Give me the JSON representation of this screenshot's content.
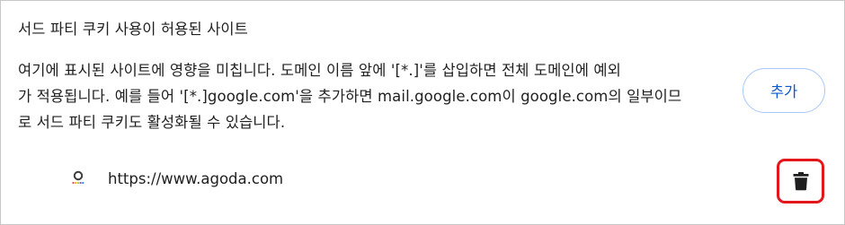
{
  "section": {
    "title": "서드 파티 쿠키 사용이 허용된 사이트",
    "description_lines": [
      "여기에 표시된 사이트에 영향을 미칩니다. 도메인 이름 앞에 '[*.]'를 삽입하면 전체 도메인에 예외",
      "가 적용됩니다. 예를 들어 '[*.]google.com'을 추가하면 mail.google.com이 google.com의 일부이므",
      "로 서드 파티 쿠키도 활성화될 수 있습니다."
    ],
    "add_button_label": "추가"
  },
  "sites": [
    {
      "url": "https://www.agoda.com",
      "favicon_icon": "agoda-favicon-icon",
      "delete_icon": "trash-icon"
    }
  ],
  "colors": {
    "accent": "#0b57d0",
    "button_border": "#a8c7fa",
    "highlight": "#e3171b",
    "text": "#1f1f1f",
    "icon": "#1f1f1f"
  }
}
